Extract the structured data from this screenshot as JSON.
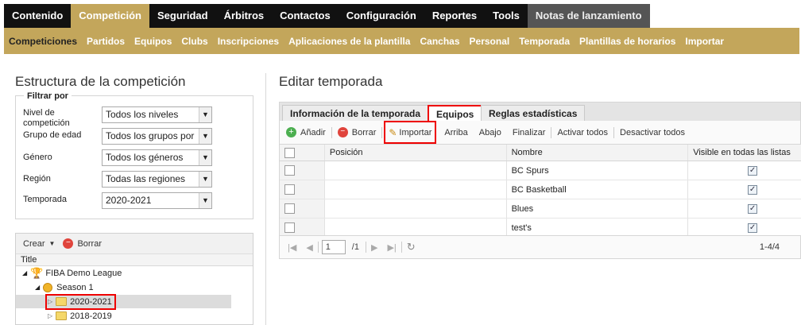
{
  "top_nav": {
    "items": [
      {
        "label": "Contenido"
      },
      {
        "label": "Competición"
      },
      {
        "label": "Seguridad"
      },
      {
        "label": "Árbitros"
      },
      {
        "label": "Contactos"
      },
      {
        "label": "Configuración"
      },
      {
        "label": "Reportes"
      },
      {
        "label": "Tools"
      },
      {
        "label": "Notas de lanzamiento"
      }
    ],
    "active": "Competición"
  },
  "sub_nav": {
    "items": [
      {
        "label": "Competiciones"
      },
      {
        "label": "Partidos"
      },
      {
        "label": "Equipos"
      },
      {
        "label": "Clubs"
      },
      {
        "label": "Inscripciones"
      },
      {
        "label": "Aplicaciones de la plantilla"
      },
      {
        "label": "Canchas"
      },
      {
        "label": "Personal"
      },
      {
        "label": "Temporada"
      },
      {
        "label": "Plantillas de horarios"
      },
      {
        "label": "Importar"
      }
    ],
    "active": "Competiciones"
  },
  "left": {
    "title": "Estructura de la competición",
    "filter": {
      "legend": "Filtrar por",
      "rows": [
        {
          "label": "Nivel de competición",
          "value": "Todos los niveles"
        },
        {
          "label": "Grupo de edad",
          "value": "Todos los grupos por"
        },
        {
          "label": "Género",
          "value": "Todos los géneros"
        },
        {
          "label": "Región",
          "value": "Todas las regiones"
        },
        {
          "label": "Temporada",
          "value": "2020-2021"
        }
      ]
    },
    "tree": {
      "create_label": "Crear",
      "delete_label": "Borrar",
      "column_title": "Title",
      "nodes": [
        {
          "label": "FIBA Demo League"
        },
        {
          "label": "Season 1"
        },
        {
          "label": "2020-2021"
        },
        {
          "label": "2018-2019"
        }
      ]
    }
  },
  "right": {
    "title": "Editar temporada",
    "tabs": [
      {
        "label": "Información de la temporada"
      },
      {
        "label": "Equipos"
      },
      {
        "label": "Reglas estadísticas"
      }
    ],
    "active_tab": "Equipos",
    "toolbar": {
      "add": "Añadir",
      "delete": "Borrar",
      "import": "Importar",
      "up": "Arriba",
      "down": "Abajo",
      "finish": "Finalizar",
      "activate_all": "Activar todos",
      "deactivate_all": "Desactivar todos"
    },
    "grid": {
      "columns": [
        "Posición",
        "Nombre",
        "Visible en todas las listas"
      ],
      "rows": [
        {
          "position": "",
          "name": "BC Spurs",
          "visible": true
        },
        {
          "position": "",
          "name": "BC Basketball",
          "visible": true
        },
        {
          "position": "",
          "name": "Blues",
          "visible": true
        },
        {
          "position": "",
          "name": "test's",
          "visible": true
        }
      ]
    },
    "pager": {
      "page": "1",
      "of": "/1",
      "range": "1-4/4"
    }
  },
  "colors": {
    "accent": "#c3a65b",
    "nav_bg": "#111111",
    "highlight": "#ee0000"
  }
}
